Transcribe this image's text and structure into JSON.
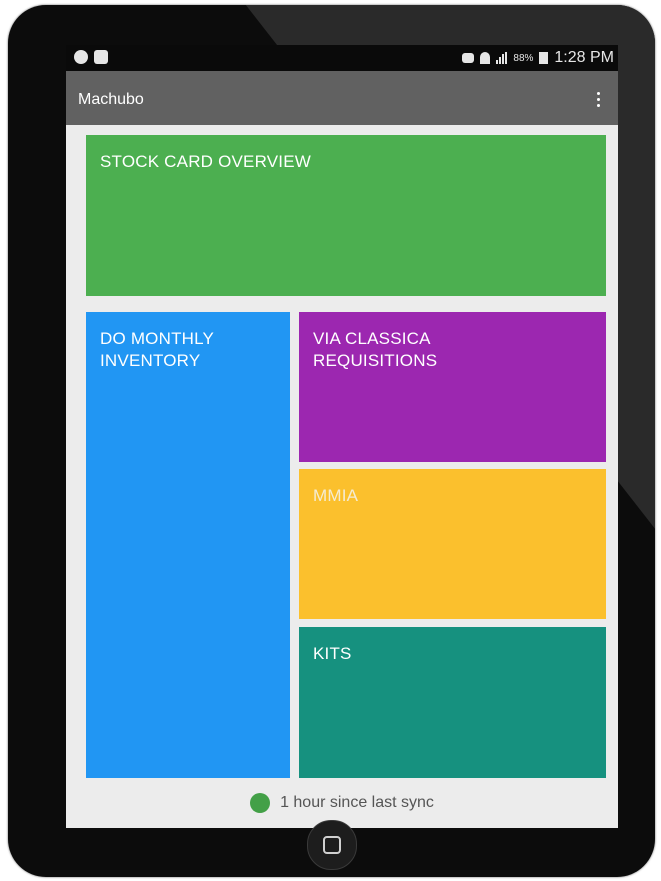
{
  "status_bar": {
    "left_icons": [
      "skype-icon",
      "photo-notification-icon"
    ],
    "right_icons": [
      "mute-icon",
      "wifi-icon",
      "signal-icon",
      "battery-icon"
    ],
    "battery": "88%",
    "time": "1:28 PM"
  },
  "app_bar": {
    "title": "Machubo",
    "menu_icon": "overflow-menu-icon"
  },
  "tiles": [
    {
      "label": "STOCK CARD OVERVIEW",
      "color": "#4caf50"
    },
    {
      "label": "DO MONTHLY INVENTORY",
      "color": "#2196f3"
    },
    {
      "label": "VIA CLASSICA REQUISITIONS",
      "color": "#9c27b0"
    },
    {
      "label": "MMIA",
      "color": "#fbc02d"
    },
    {
      "label": "KITS",
      "color": "#16917f"
    }
  ],
  "sync": {
    "text": "1 hour since last sync",
    "status_color": "#43a047"
  },
  "device": {
    "home_button_icon": "recent-apps-icon"
  }
}
